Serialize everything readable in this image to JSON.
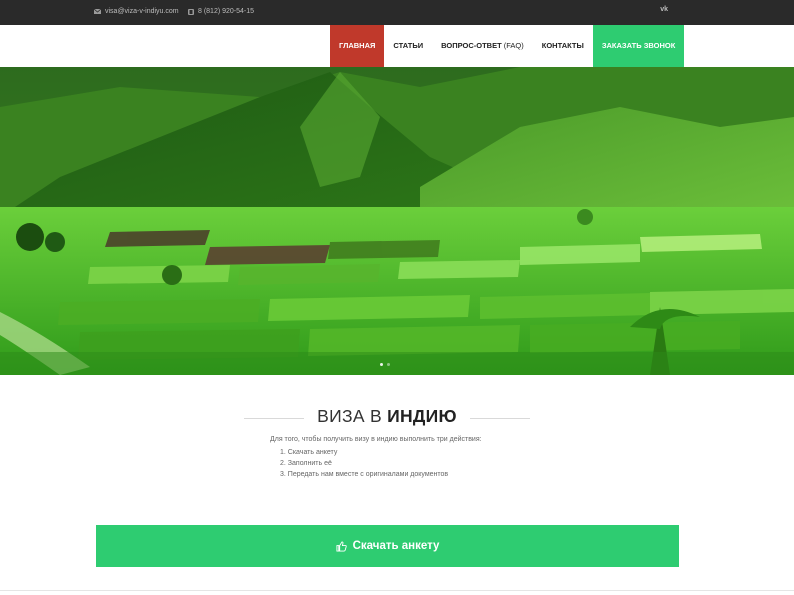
{
  "topbar": {
    "email": "visa@viza-v-indiyu.com",
    "phone": "8 (812) 920-54-15",
    "social": "vk",
    "email_icon": "envelope-icon",
    "phone_icon": "phone-icon"
  },
  "nav": {
    "items": [
      {
        "label": "Главная"
      },
      {
        "label": "Статьи"
      },
      {
        "label": "Вопрос-ответ",
        "suffix": "(FAQ)"
      },
      {
        "label": "Контакты"
      },
      {
        "label": "Заказать звонок"
      }
    ]
  },
  "hero": {
    "slides": 2,
    "active_slide": 1
  },
  "section": {
    "title_light": "ВИЗА В",
    "title_bold": "ИНДИЮ",
    "intro": "Для того, чтобы получить визу в индию выполнить три действия:",
    "steps": [
      "1. Скачать анкету",
      "2. Заполнить её",
      "3. Передать нам вместе с оригиналами документов"
    ]
  },
  "download_button": {
    "label": "Скачать анкету",
    "icon": "thumbs-up-icon"
  },
  "colors": {
    "topbar_bg": "#2a2a2a",
    "active_nav": "#c0392b",
    "accent_green": "#2ecc71"
  }
}
